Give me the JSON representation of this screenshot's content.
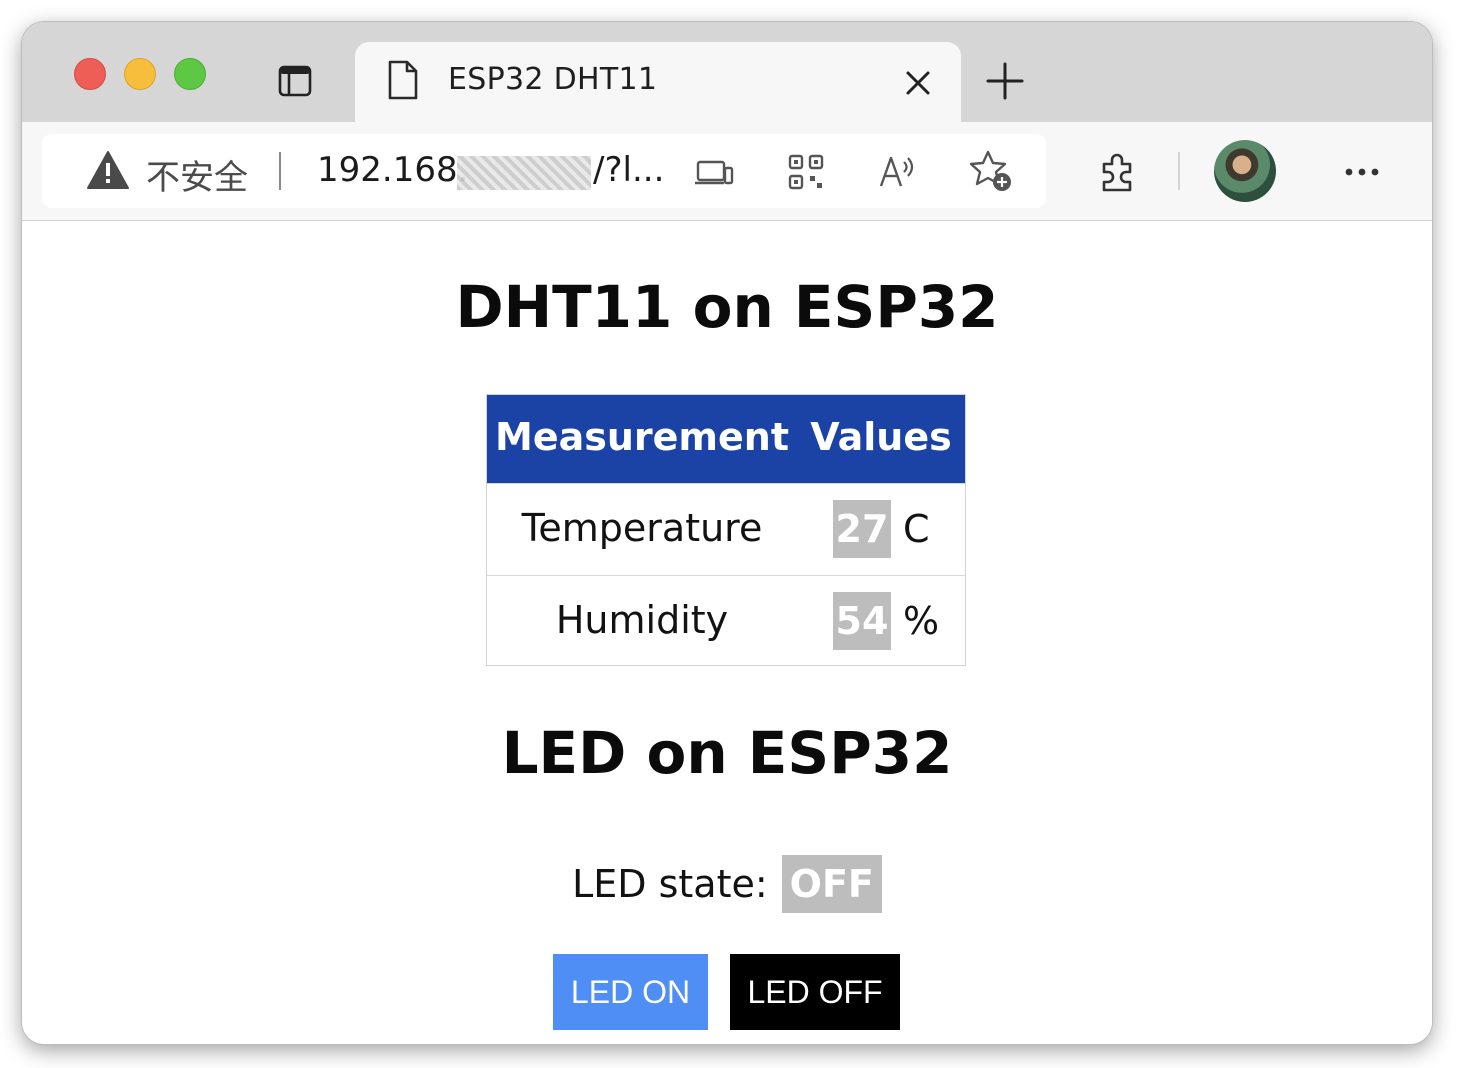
{
  "browser": {
    "tab": {
      "title": "ESP32 DHT11"
    },
    "address_bar": {
      "security_label": "不安全",
      "url_prefix": "192.168.",
      "url_suffix": "/?l..."
    }
  },
  "page": {
    "sensor_heading": "DHT11 on ESP32",
    "table": {
      "headers": [
        "Measurement",
        "Values"
      ],
      "rows": [
        {
          "label": "Temperature",
          "value": "27",
          "unit": "C"
        },
        {
          "label": "Humidity",
          "value": "54",
          "unit": "%"
        }
      ]
    },
    "led_heading": "LED on ESP32",
    "led_state_label": "LED state:",
    "led_state_value": "OFF",
    "buttons": {
      "on_label": "LED ON",
      "off_label": "LED OFF"
    }
  },
  "colors": {
    "table_header": "#1a43a5",
    "value_badge": "#bdbdbd",
    "led_on_button": "#4f8ef4",
    "led_off_button": "#000000"
  },
  "icons": [
    "tab-actions-icon",
    "page-icon",
    "close-icon",
    "new-tab-icon",
    "warning-icon",
    "device-icon",
    "qr-code-icon",
    "read-aloud-icon",
    "add-favorite-icon",
    "extensions-icon",
    "more-icon"
  ]
}
